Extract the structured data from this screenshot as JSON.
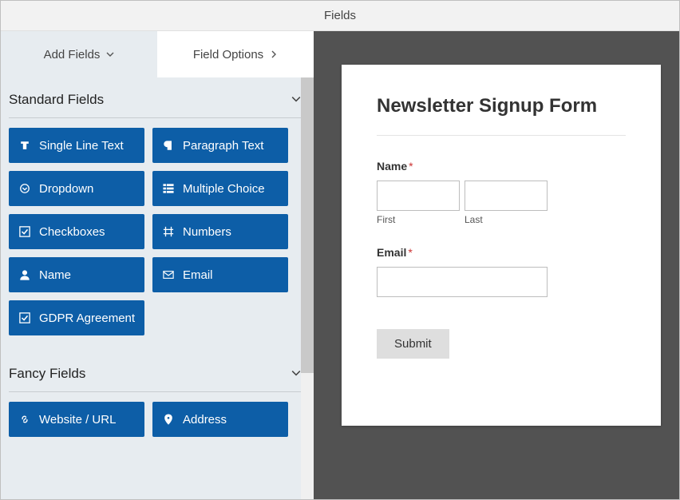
{
  "window": {
    "title": "Fields"
  },
  "tabs": {
    "add": "Add Fields",
    "options": "Field Options"
  },
  "sections": {
    "standard": {
      "title": "Standard Fields",
      "items": [
        {
          "icon": "text-icon",
          "label": "Single Line Text"
        },
        {
          "icon": "paragraph-icon",
          "label": "Paragraph Text"
        },
        {
          "icon": "dropdown-icon",
          "label": "Dropdown"
        },
        {
          "icon": "multiple-choice-icon",
          "label": "Multiple Choice"
        },
        {
          "icon": "checkboxes-icon",
          "label": "Checkboxes"
        },
        {
          "icon": "numbers-icon",
          "label": "Numbers"
        },
        {
          "icon": "name-icon",
          "label": "Name"
        },
        {
          "icon": "email-icon",
          "label": "Email"
        },
        {
          "icon": "gdpr-icon",
          "label": "GDPR Agreement"
        }
      ]
    },
    "fancy": {
      "title": "Fancy Fields",
      "items": [
        {
          "icon": "url-icon",
          "label": "Website / URL"
        },
        {
          "icon": "address-icon",
          "label": "Address"
        }
      ]
    }
  },
  "form": {
    "title": "Newsletter Signup Form",
    "name_label": "Name",
    "first_sub": "First",
    "last_sub": "Last",
    "email_label": "Email",
    "submit_label": "Submit",
    "required_mark": "*"
  }
}
